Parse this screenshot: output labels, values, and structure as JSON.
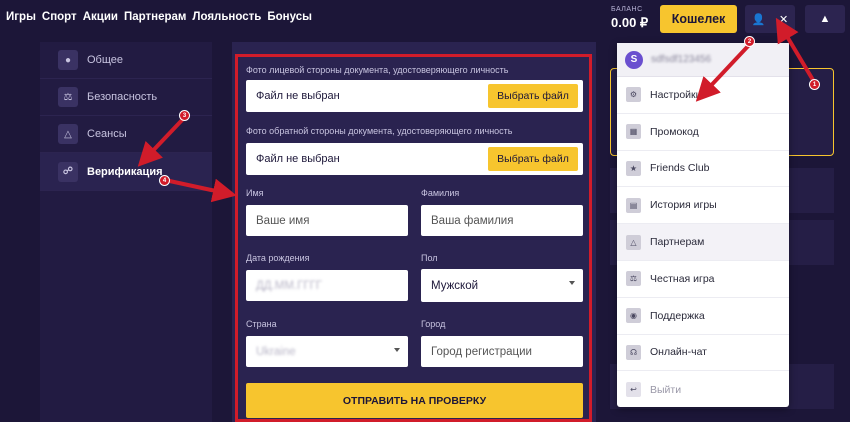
{
  "nav": [
    "Игры",
    "Спорт",
    "Акции",
    "Партнерам",
    "Лояльность",
    "Бонусы"
  ],
  "balance": {
    "label": "БАЛАНС",
    "value": "0.00 ₽"
  },
  "wallet_label": "Кошелек",
  "sidebar": [
    {
      "label": "Общее",
      "icon": "user-icon"
    },
    {
      "label": "Безопасность",
      "icon": "scales-icon"
    },
    {
      "label": "Сеансы",
      "icon": "network-icon"
    },
    {
      "label": "Верификация",
      "icon": "shield-icon"
    }
  ],
  "form": {
    "front_label": "Фото лицевой стороны документа, удостоверяющего личность",
    "back_label": "Фото обратной стороны документа, удостоверяющего личность",
    "no_file": "Файл не выбран",
    "choose_file": "Выбрать файл",
    "name_label": "Имя",
    "name_placeholder": "Ваше имя",
    "surname_label": "Фамилия",
    "surname_placeholder": "Ваша фамилия",
    "birth_label": "Дата рождения",
    "birth_value": "ДД.ММ.ГГГГ",
    "gender_label": "Пол",
    "gender_value": "Мужской",
    "country_label": "Страна",
    "country_value": "Ukraine",
    "city_label": "Город",
    "city_placeholder": "Город регистрации",
    "submit": "ОТПРАВИТЬ НА ПРОВЕРКУ"
  },
  "dropdown": {
    "avatar_letter": "S",
    "username": "sdfsdf123456",
    "items": [
      {
        "label": "Настройки",
        "icon": "gear-icon"
      },
      {
        "label": "Промокод",
        "icon": "gift-icon"
      },
      {
        "label": "Friends Club",
        "icon": "star-icon"
      },
      {
        "label": "История игры",
        "icon": "history-icon"
      },
      {
        "label": "Партнерам",
        "icon": "network-icon"
      },
      {
        "label": "Честная игра",
        "icon": "scales-icon"
      },
      {
        "label": "Поддержка",
        "icon": "lifebuoy-icon"
      },
      {
        "label": "Онлайн-чат",
        "icon": "headset-icon"
      },
      {
        "label": "Выйти",
        "icon": "logout-icon"
      }
    ]
  },
  "markers": [
    "1",
    "2",
    "3",
    "4"
  ],
  "colors": {
    "accent": "#f7c52e",
    "annotation": "#d11c2a",
    "background": "#1c1638"
  }
}
